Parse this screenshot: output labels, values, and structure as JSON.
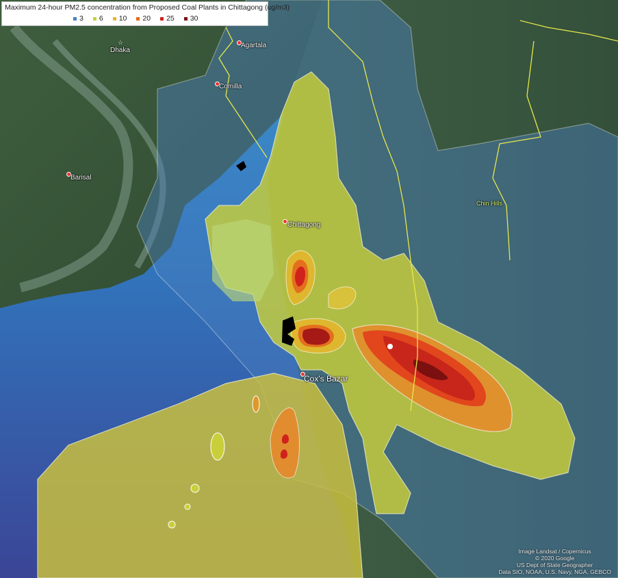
{
  "legend": {
    "title": "Maximum 24-hour PM2.5 concentration from Proposed Coal Plants in Chittagong (ug/m3)",
    "items": [
      {
        "label": "3",
        "color": "#4a7fc0"
      },
      {
        "label": "6",
        "color": "#c9cf3a"
      },
      {
        "label": "10",
        "color": "#e8b72a"
      },
      {
        "label": "20",
        "color": "#e46a1e"
      },
      {
        "label": "25",
        "color": "#d0221c"
      },
      {
        "label": "30",
        "color": "#7a1010"
      }
    ]
  },
  "places": {
    "dhaka": "Dhaka",
    "agartala": "Agartala",
    "comilla": "Comilla",
    "barisal": "Barisal",
    "chittagong": "Chittagong",
    "coxs_bazar": "Cox's Bazar",
    "chin_hills": "Chin Hills"
  },
  "attribution": {
    "line1": "Image Landsat / Copernicus",
    "line2": "© 2020 Google",
    "line3": "US Dept of State Geographer",
    "line4": "Data SIO, NOAA, U.S. Navy, NGA, GEBCO"
  },
  "colors": {
    "land": "#3e5a3c",
    "sea_shallow": "#2f9bd0",
    "sea_deep": "#3a4f9a",
    "overlay_3": "#4a7fc0",
    "overlay_6": "#c9cf3a",
    "overlay_10": "#e8b72a",
    "overlay_20": "#e46a1e",
    "overlay_25": "#d0221c",
    "overlay_30": "#7a1010",
    "border": "#e8e84a"
  }
}
